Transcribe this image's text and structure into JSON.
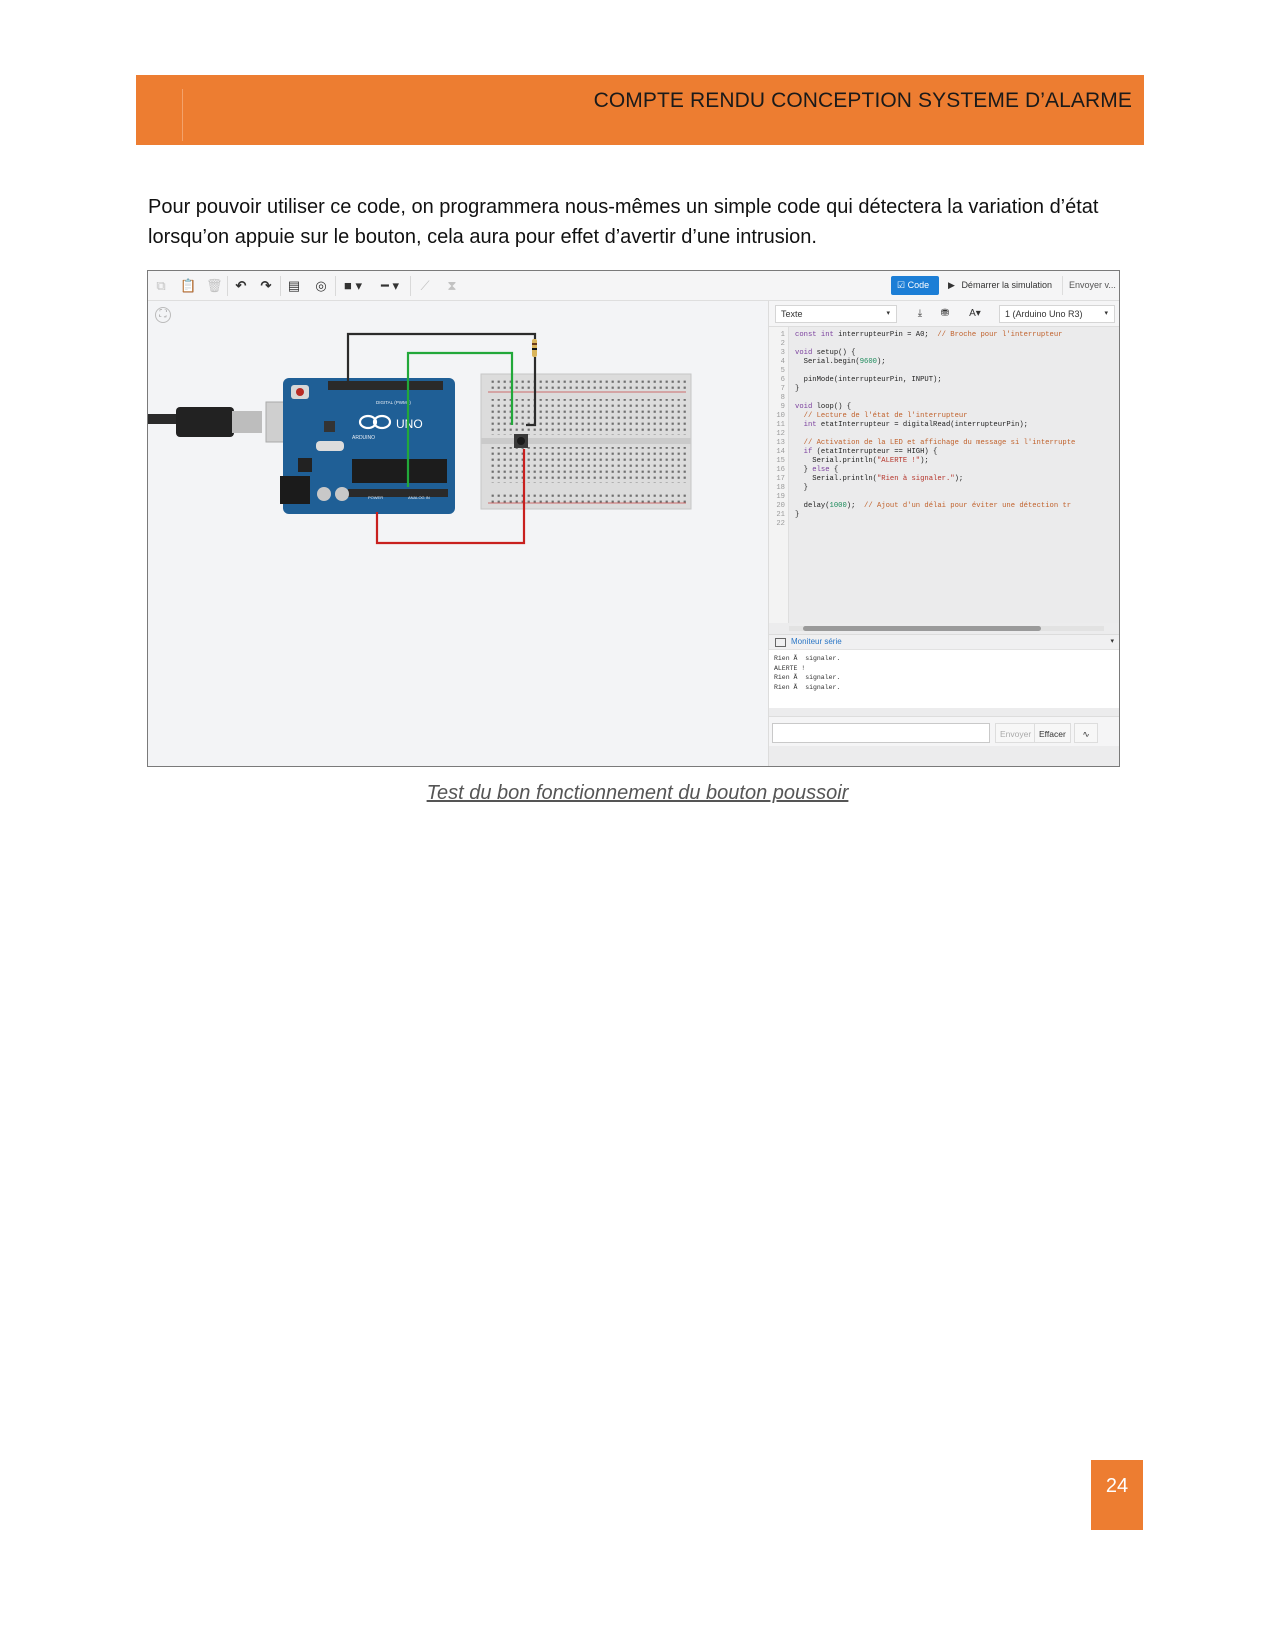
{
  "header": {
    "title": "COMPTE RENDU CONCEPTION SYSTEME D’ALARME"
  },
  "colors": {
    "accent": "#ed7d31",
    "wire_black": "#2b2b2b",
    "wire_green": "#22a83a",
    "wire_red": "#c8201e",
    "arduino_blue": "#1f5f96"
  },
  "body": {
    "paragraph": "Pour pouvoir utiliser ce code, on programmera nous-mêmes un simple code qui détectera la variation d’état lorsqu’on appuie sur le bouton, cela aura pour effet d’avertir d’une intrusion."
  },
  "screenshot": {
    "toolbar": {
      "icons": [
        "copy-icon",
        "paste-icon",
        "delete-icon",
        "undo-icon",
        "redo-icon",
        "note-icon",
        "view-icon",
        "fill-color-icon",
        "line-style-icon",
        "rotate-icon",
        "flip-icon"
      ],
      "code_label": "Code",
      "simulate_label": "Démarrer la simulation",
      "send_label": "Envoyer v..."
    },
    "arduino": {
      "brand": "ARDUINO",
      "model": "UNO",
      "digital_label": "DIGITAL (PWM~)",
      "power_label": "POWER",
      "analog_label": "ANALOG IN"
    },
    "editor": {
      "mode_select": "Texte",
      "board_select": "1 (Arduino Uno R3)",
      "code_lines": [
        {
          "n": "1",
          "html": "<span class='kw'>const int</span> interrupteurPin = A0;  <span class='cm'>// Broche pour l'interrupteur</span>"
        },
        {
          "n": "2",
          "html": ""
        },
        {
          "n": "3",
          "html": "<span class='kw'>void</span> setup() {"
        },
        {
          "n": "4",
          "html": "  Serial.begin(<span class='nm'>9600</span>);"
        },
        {
          "n": "5",
          "html": ""
        },
        {
          "n": "6",
          "html": "  pinMode(interrupteurPin, INPUT);"
        },
        {
          "n": "7",
          "html": "}"
        },
        {
          "n": "8",
          "html": ""
        },
        {
          "n": "9",
          "html": "<span class='kw'>void</span> loop() {"
        },
        {
          "n": "10",
          "html": "  <span class='cm'>// Lecture de l'état de l'interrupteur</span>"
        },
        {
          "n": "11",
          "html": "  <span class='kw'>int</span> etatInterrupteur = digitalRead(interrupteurPin);"
        },
        {
          "n": "12",
          "html": ""
        },
        {
          "n": "13",
          "html": "  <span class='cm'>// Activation de la LED et affichage du message si l'interrupte</span>"
        },
        {
          "n": "14",
          "html": "  <span class='kw'>if</span> (etatInterrupteur == HIGH) {"
        },
        {
          "n": "15",
          "html": "    Serial.println(<span class='st'>\"ALERTE !\"</span>);"
        },
        {
          "n": "16",
          "html": "  } <span class='kw'>else</span> {"
        },
        {
          "n": "17",
          "html": "    Serial.println(<span class='st'>\"Rien à signaler.\"</span>);"
        },
        {
          "n": "18",
          "html": "  }"
        },
        {
          "n": "19",
          "html": ""
        },
        {
          "n": "20",
          "html": "  delay(<span class='nm'>1000</span>);  <span class='cm'>// Ajout d'un délai pour éviter une détection tr</span>"
        },
        {
          "n": "21",
          "html": "}"
        },
        {
          "n": "22",
          "html": ""
        }
      ]
    },
    "monitor": {
      "title": "Moniteur série",
      "lines": [
        "Rien Ã  signaler.",
        "ALERTE !",
        "Rien Ã  signaler.",
        "Rien Ã  signaler."
      ],
      "send_label": "Envoyer",
      "clear_label": "Effacer"
    }
  },
  "caption": "Test du bon fonctionnement du bouton poussoir",
  "page_number": "24"
}
